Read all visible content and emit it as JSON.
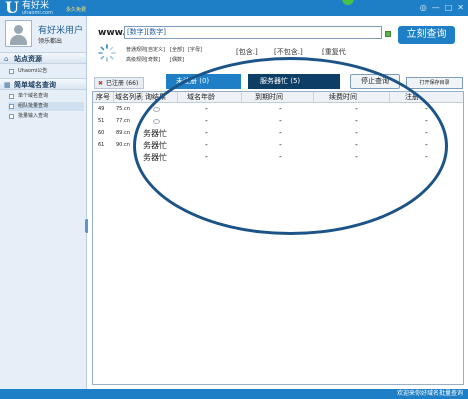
{
  "app": {
    "logo_letter": "U",
    "brand": "有好米",
    "domain": "uhaomi.com",
    "free_badge": "永久免费",
    "window_buttons": [
      "◎",
      "—",
      "□",
      "✕"
    ]
  },
  "sidebar": {
    "username": "有好米用户",
    "logout": "领乐都出",
    "sections": [
      {
        "label": "站点资源",
        "items": [
          {
            "label": "Uhaomi公告"
          }
        ]
      },
      {
        "label": "简单域名查询",
        "items": [
          {
            "label": "单个域名查询"
          },
          {
            "label": "组队批量查询"
          },
          {
            "label": "批量输入查询"
          }
        ]
      }
    ]
  },
  "query": {
    "prefix": "www.",
    "value": "[数字][数字]",
    "button": "立刻查询",
    "options_row1": [
      "普通规则",
      "[自定义]",
      "[全部]",
      "[字母]"
    ],
    "options_row2": [
      "高级规则",
      "[奇数]",
      "[偶数]"
    ],
    "brackets": [
      "[包含.]",
      "[不包含.]",
      "[重复代"
    ]
  },
  "tabs": {
    "registered": "已注册",
    "registered_count": "(66)",
    "unregistered": "未注册",
    "unregistered_count": "(0)",
    "busy": "服务器忙",
    "busy_count": "(5)"
  },
  "buttons": {
    "stop": "停止查询",
    "open_dir": "打开保存目录"
  },
  "table": {
    "columns": [
      "序号",
      "域名列表",
      "询结果",
      "域名年龄",
      "到期时间",
      "续费时间",
      "注册"
    ],
    "rows": [
      {
        "no": "49",
        "domain": "75.cn",
        "result": "",
        "age": "-",
        "expire": "-",
        "renew": "-",
        "reg": "-"
      },
      {
        "no": "51",
        "domain": "77.cn",
        "result": "",
        "age": "-",
        "expire": "-",
        "renew": "-",
        "reg": "-"
      },
      {
        "no": "60",
        "domain": "89.cn",
        "result": "务器忙",
        "age": "-",
        "expire": "-",
        "renew": "-",
        "reg": "-"
      },
      {
        "no": "61",
        "domain": "90.cn",
        "result": "务器忙",
        "age": "-",
        "expire": "-",
        "renew": "-",
        "reg": "-"
      },
      {
        "no": "",
        "domain": "",
        "result": "务器忙",
        "age": "-",
        "expire": "-",
        "renew": "-",
        "reg": "-"
      }
    ]
  },
  "footer": {
    "text": "欢迎来你好域名批量查询"
  },
  "colors": {
    "brand_blue": "#1f7fc6",
    "dark_tab": "#0d3f66",
    "annotation_ring": "#1d5488"
  }
}
